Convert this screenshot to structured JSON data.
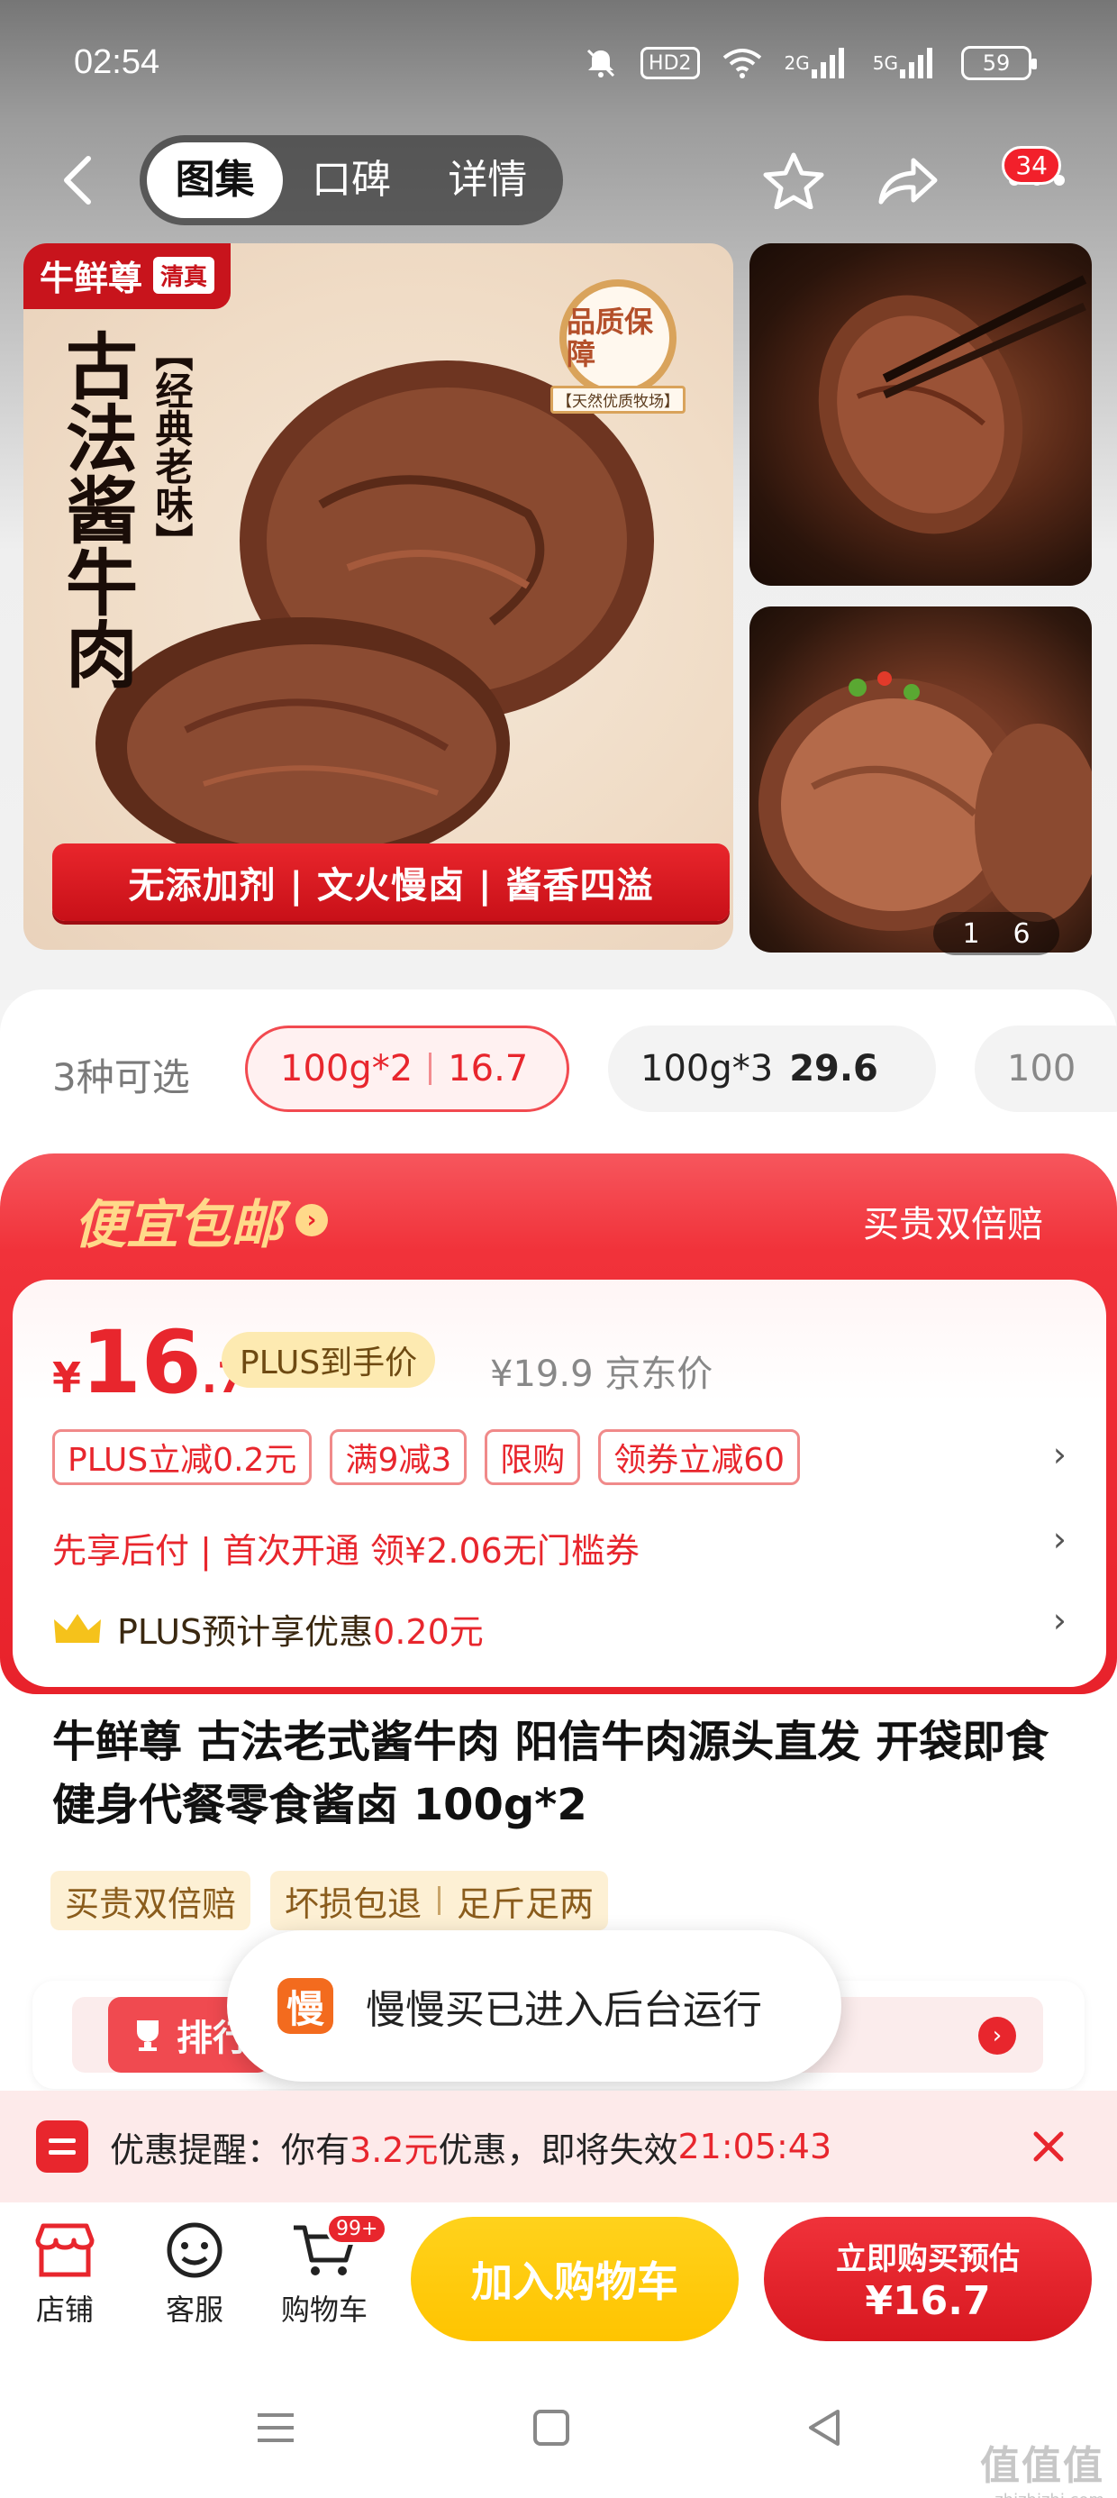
{
  "status_bar": {
    "time": "02:54",
    "hd": "HD2",
    "net1": "2G",
    "net2": "5G",
    "battery": "59"
  },
  "nav": {
    "tabs": [
      "图集",
      "口碑",
      "详情"
    ],
    "active_tab": "图集",
    "more_badge": "34"
  },
  "gallery": {
    "brand": "牛鲜尊",
    "halal": "清真",
    "title_vertical": "古法酱牛肉",
    "subtitle_vertical": "【经典老味】",
    "quality_seal": "品质保障",
    "quality_ribbon": "【天然优质牧场】",
    "banner": "无添加剂 | 文火慢卤 | 酱香四溢",
    "page_current": "1",
    "page_total": "6"
  },
  "specs": {
    "label": "3种可选",
    "options": [
      {
        "name": "100g*2",
        "price": "16.7"
      },
      {
        "name": "100g*3",
        "price": "29.6"
      },
      {
        "name": "100"
      }
    ]
  },
  "promo": {
    "title": "便宜包邮",
    "title_arrow": "›",
    "right_text": "买贵双倍赔",
    "price_yen": "¥",
    "price_int": "16",
    "price_dec": ".7",
    "plus_tag": "PLUS到手价",
    "jd_price": "¥19.9",
    "jd_price_label": "京东价",
    "tags": [
      "PLUS立减0.2元",
      "满9减3",
      "限购",
      "领券立减60"
    ],
    "line1": "先享后付 | 首次开通 领¥2.06无门槛券",
    "line2_prefix": "PLUS预计享优惠",
    "line2_value": "0.20元"
  },
  "product": {
    "title": "牛鲜尊 古法老式酱牛肉 阳信牛肉源头直发 开袋即食健身代餐零食酱卤 100g*2",
    "services": [
      "买贵双倍赔",
      "坏损包退",
      "足斤足两"
    ],
    "rank_label": "排行"
  },
  "toast": {
    "icon_char": "慢",
    "text": "慢慢买已进入后台运行"
  },
  "reminder": {
    "prefix": "优惠提醒：你有",
    "amount": "3.2元",
    "middle": "优惠，即将失效",
    "countdown": "21:05:43"
  },
  "actionbar": {
    "shop": "店铺",
    "service": "客服",
    "cart": "购物车",
    "cart_badge": "99+",
    "add_to_cart": "加入购物车",
    "buy_line1": "立即购买预估",
    "buy_line2": "¥16.7"
  },
  "watermark": {
    "line1": "值值值",
    "line2": "zhizhizhi.com"
  },
  "colors": {
    "brand_red": "#e8262d",
    "gold": "#ffd98a",
    "yellow_button": "#ffc400"
  }
}
